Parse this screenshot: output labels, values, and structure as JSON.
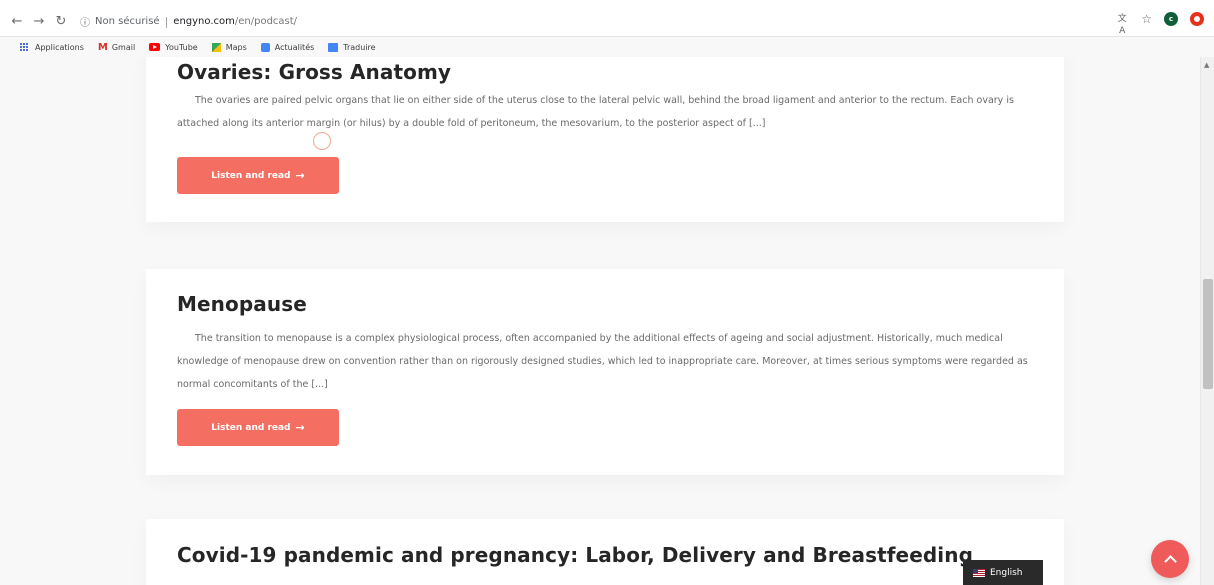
{
  "browser": {
    "security_label": "Non sécurisé",
    "url_domain": "engyno.com",
    "url_path": "/en/podcast/",
    "bookmarks": [
      {
        "label": "Applications",
        "icon": "apps-icon"
      },
      {
        "label": "Gmail",
        "icon": "gmail-icon"
      },
      {
        "label": "YouTube",
        "icon": "youtube-icon"
      },
      {
        "label": "Maps",
        "icon": "maps-icon"
      },
      {
        "label": "Actualités",
        "icon": "news-icon"
      },
      {
        "label": "Traduire",
        "icon": "translate-icon"
      }
    ],
    "profile_initial": "c"
  },
  "posts": [
    {
      "title": "Ovaries: Gross Anatomy",
      "excerpt": "The ovaries are paired pelvic organs that lie on either side of the uterus close to the lateral pelvic wall, behind the broad ligament and anterior to the rectum. Each ovary is attached along its anterior margin (or hilus) by a double fold of peritoneum, the mesovarium, to the posterior aspect of [...]",
      "button_label": "Listen and read"
    },
    {
      "title": "Menopause",
      "excerpt": "The transition to menopause is a complex physiological process, often accompanied by the additional effects of ageing and social adjustment. Historically, much medical knowledge of menopause drew on convention rather than on rigorously designed studies, which led to inappropriate care. Moreover, at times serious symptoms were regarded as normal concomitants of the [...]",
      "button_label": "Listen and read"
    },
    {
      "title": "Covid-19 pandemic and pregnancy: Labor, Delivery and Breastfeeding"
    }
  ],
  "language_switcher": {
    "label": "English"
  },
  "colors": {
    "accent": "#f56e62",
    "title": "#262626",
    "text": "#6a6a6a"
  }
}
